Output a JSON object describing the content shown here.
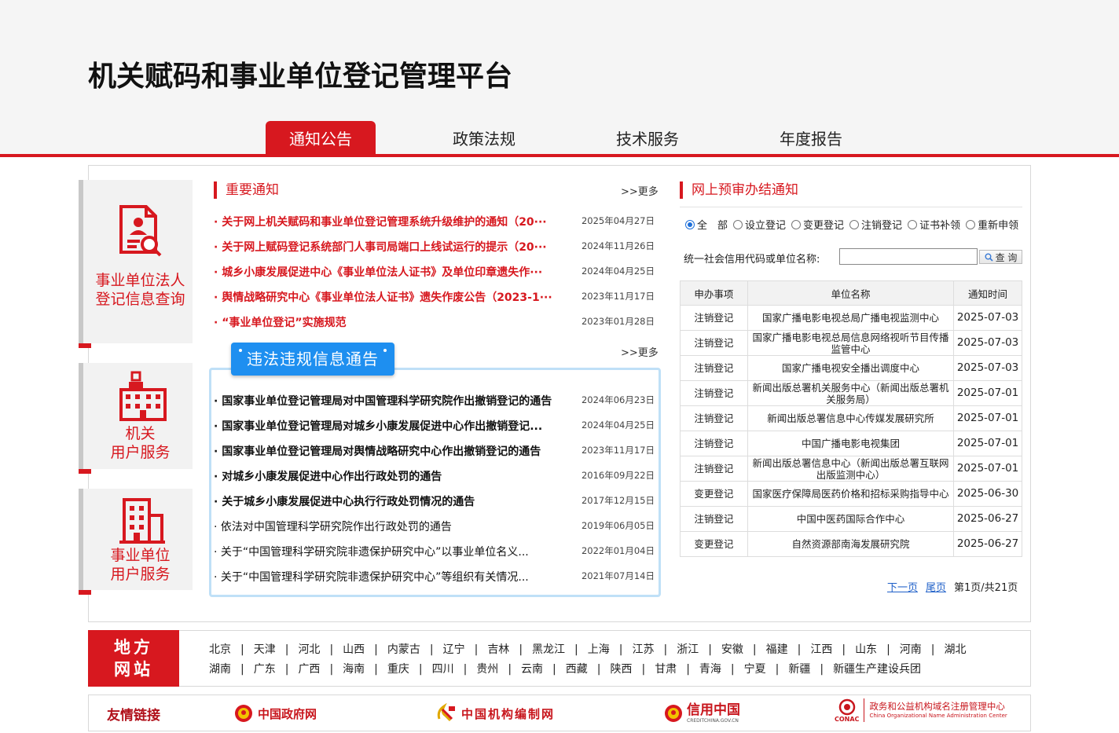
{
  "site": {
    "title": "机关赋码和事业单位登记管理平台"
  },
  "nav": [
    {
      "label": "通知公告"
    },
    {
      "label": "政策法规"
    },
    {
      "label": "技术服务"
    },
    {
      "label": "年度报告"
    }
  ],
  "side": [
    {
      "label1": "事业单位法人",
      "label2": "登记信息查询",
      "icon": "person-search-document-icon"
    },
    {
      "label1": "机关",
      "label2": "用户服务",
      "icon": "government-building-icon"
    },
    {
      "label1": "事业单位",
      "label2": "用户服务",
      "icon": "office-building-icon"
    }
  ],
  "notices": {
    "title": "重要通知",
    "more": ">>更多",
    "items": [
      {
        "text": "· 关于网上机关赋码和事业单位登记管理系统升级维护的通知（20···",
        "date": "2025年04月27日"
      },
      {
        "text": "· 关于网上赋码登记系统部门人事司局端口上线试运行的提示（20···",
        "date": "2024年11月26日"
      },
      {
        "text": "· 城乡小康发展促进中心《事业单位法人证书》及单位印章遗失作···",
        "date": "2024年04月25日"
      },
      {
        "text": "· 舆情战略研究中心《事业单位法人证书》遗失作废公告（2023-1···",
        "date": "2023年11月17日"
      },
      {
        "text": "· “事业单位登记”实施规范",
        "date": "2023年01月28日"
      }
    ]
  },
  "violations": {
    "title": "违法违规信息通告",
    "more": ">>更多",
    "items": [
      {
        "text": "· 国家事业单位登记管理局对中国管理科学研究院作出撤销登记的通告",
        "date": "2024年06月23日"
      },
      {
        "text": "· 国家事业单位登记管理局对城乡小康发展促进中心作出撤销登记...",
        "date": "2024年04月25日"
      },
      {
        "text": "· 国家事业单位登记管理局对舆情战略研究中心作出撤销登记的通告",
        "date": "2023年11月17日"
      },
      {
        "text": "· 对城乡小康发展促进中心作出行政处罚的通告",
        "date": "2016年09月22日"
      },
      {
        "text": "· 关于城乡小康发展促进中心执行行政处罚情况的通告",
        "date": "2017年12月15日"
      },
      {
        "text": "· 依法对中国管理科学研究院作出行政处罚的通告",
        "date": "2019年06月05日"
      },
      {
        "text": "· 关于“中国管理科学研究院非遗保护研究中心”以事业单位名义...",
        "date": "2022年01月04日"
      },
      {
        "text": "· 关于“中国管理科学研究院非遗保护研究中心”等组织有关情况...",
        "date": "2021年07月14日"
      }
    ]
  },
  "prereview": {
    "title": "网上预审办结通知",
    "radios": [
      {
        "label": "全　部",
        "checked": true
      },
      {
        "label": "设立登记",
        "checked": false
      },
      {
        "label": "变更登记",
        "checked": false
      },
      {
        "label": "注销登记",
        "checked": false
      },
      {
        "label": "证书补领",
        "checked": false
      },
      {
        "label": "重新申领",
        "checked": false
      }
    ],
    "search_label": "统一社会信用代码或单位名称:",
    "search_value": "",
    "search_button": "查 询",
    "columns": [
      "申办事项",
      "单位名称",
      "通知时间"
    ],
    "rows": [
      [
        "注销登记",
        "国家广播电影电视总局广播电视监测中心",
        "2025-07-03"
      ],
      [
        "注销登记",
        "国家广播电影电视总局信息网络视听节目传播监管中心",
        "2025-07-03"
      ],
      [
        "注销登记",
        "国家广播电视安全播出调度中心",
        "2025-07-03"
      ],
      [
        "注销登记",
        "新闻出版总署机关服务中心（新闻出版总署机关服务局）",
        "2025-07-01"
      ],
      [
        "注销登记",
        "新闻出版总署信息中心传媒发展研究所",
        "2025-07-01"
      ],
      [
        "注销登记",
        "中国广播电影电视集团",
        "2025-07-01"
      ],
      [
        "注销登记",
        "新闻出版总署信息中心（新闻出版总署互联网出版监测中心）",
        "2025-07-01"
      ],
      [
        "变更登记",
        "国家医疗保障局医药价格和招标采购指导中心",
        "2025-06-30"
      ],
      [
        "注销登记",
        "中国中医药国际合作中心",
        "2025-06-27"
      ],
      [
        "变更登记",
        "自然资源部南海发展研究院",
        "2025-06-27"
      ]
    ],
    "pager": {
      "next": "下一页",
      "last": "尾页",
      "info": "第1页/共21页"
    }
  },
  "regions": {
    "tag1": "地方",
    "tag2": "网站",
    "line1": [
      "北京",
      "天津",
      "河北",
      "山西",
      "内蒙古",
      "辽宁",
      "吉林",
      "黑龙江",
      "上海",
      "江苏",
      "浙江",
      "安徽",
      "福建",
      "江西",
      "山东",
      "河南",
      "湖北"
    ],
    "line2": [
      "湖南",
      "广东",
      "广西",
      "海南",
      "重庆",
      "四川",
      "贵州",
      "云南",
      "西藏",
      "陕西",
      "甘肃",
      "青海",
      "宁夏",
      "新疆",
      "新疆生产建设兵团"
    ]
  },
  "friend_links": {
    "label": "友情链接",
    "items": [
      {
        "text": "中国政府网",
        "icon": "national-emblem-icon"
      },
      {
        "text": "中国机构编制网",
        "icon": "party-emblem-icon"
      },
      {
        "text": "信用中国",
        "sub": "CREDITCHINA.GOV.CN",
        "icon": "national-emblem-icon"
      },
      {
        "text": "政务和公益机构域名注册管理中心",
        "sub": "China Organizational Name Administration Center",
        "badge": "CONAC",
        "icon": "conac-logo-icon"
      }
    ]
  },
  "colors": {
    "brand_red": "#d7181f",
    "accent_blue": "#1e8ff0",
    "link_blue": "#1e5fc8"
  }
}
